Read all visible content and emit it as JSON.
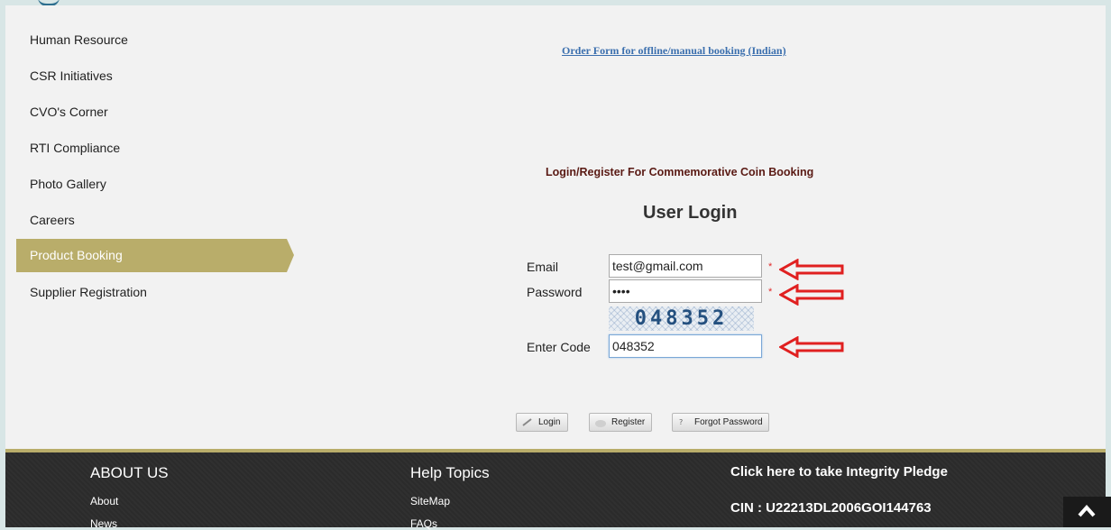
{
  "sidebar": {
    "items": [
      {
        "label": "Human Resource"
      },
      {
        "label": "CSR Initiatives"
      },
      {
        "label": "CVO's Corner"
      },
      {
        "label": "RTI Compliance"
      },
      {
        "label": "Photo Gallery"
      },
      {
        "label": "Careers"
      },
      {
        "label": "Product Booking",
        "active": true
      },
      {
        "label": "Supplier Registration"
      }
    ]
  },
  "main": {
    "order_form_link": "Order Form for offline/manual booking (Indian)",
    "login_register_title": "Login/Register For Commemorative Coin Booking",
    "user_login_title": "User Login",
    "form": {
      "email_label": "Email",
      "email_value": "test@gmail.com",
      "password_label": "Password",
      "password_value": "••••",
      "captcha_text": "048352",
      "code_label": "Enter Code",
      "code_value": "048352",
      "required_mark": "*"
    },
    "buttons": {
      "login": "Login",
      "register": "Register",
      "forgot": "Forgot Password"
    },
    "annotation_arrow_color": "#e02020"
  },
  "footer": {
    "about_heading": "ABOUT US",
    "about_links": [
      "About",
      "News"
    ],
    "help_heading": "Help Topics",
    "help_links": [
      "SiteMap",
      "FAQs"
    ],
    "pledge_text": "Click here to take Integrity Pledge",
    "cin_text": "CIN : U22213DL2006GOI144763",
    "accent": "#b9ad6a"
  }
}
